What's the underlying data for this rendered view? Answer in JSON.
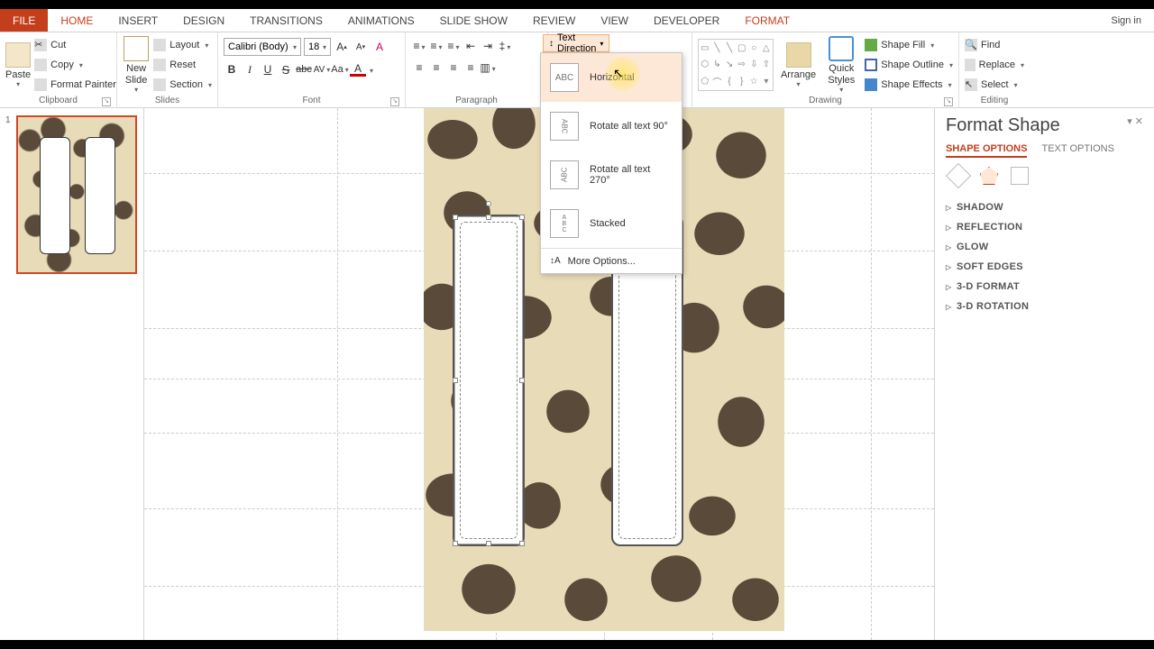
{
  "tabs": {
    "file": "FILE",
    "home": "HOME",
    "insert": "INSERT",
    "design": "DESIGN",
    "transitions": "TRANSITIONS",
    "animations": "ANIMATIONS",
    "slideshow": "SLIDE SHOW",
    "review": "REVIEW",
    "view": "VIEW",
    "developer": "DEVELOPER",
    "format": "FORMAT",
    "signin": "Sign in"
  },
  "ribbon": {
    "clipboard": {
      "label": "Clipboard",
      "paste": "Paste",
      "cut": "Cut",
      "copy": "Copy",
      "format_painter": "Format Painter"
    },
    "slides": {
      "label": "Slides",
      "new_slide": "New\nSlide",
      "layout": "Layout",
      "reset": "Reset",
      "section": "Section"
    },
    "font": {
      "label": "Font",
      "name": "Calibri (Body)",
      "size": "18"
    },
    "paragraph": {
      "label": "Paragraph",
      "text_direction": "Text Direction",
      "menu": {
        "horizontal": "Horizontal",
        "rotate90": "Rotate all text 90°",
        "rotate270": "Rotate all text 270°",
        "stacked": "Stacked",
        "more": "More Options..."
      }
    },
    "drawing": {
      "label": "Drawing",
      "arrange": "Arrange",
      "quick_styles": "Quick\nStyles",
      "shape_fill": "Shape Fill",
      "shape_outline": "Shape Outline",
      "shape_effects": "Shape Effects"
    },
    "editing": {
      "label": "Editing",
      "find": "Find",
      "replace": "Replace",
      "select": "Select"
    }
  },
  "thumbnails": {
    "slide1_num": "1"
  },
  "panel": {
    "title": "Format Shape",
    "tab_shape": "SHAPE OPTIONS",
    "tab_text": "TEXT OPTIONS",
    "sections": {
      "shadow": "SHADOW",
      "reflection": "REFLECTION",
      "glow": "GLOW",
      "soft_edges": "SOFT EDGES",
      "threed_format": "3-D FORMAT",
      "threed_rotation": "3-D ROTATION"
    }
  }
}
